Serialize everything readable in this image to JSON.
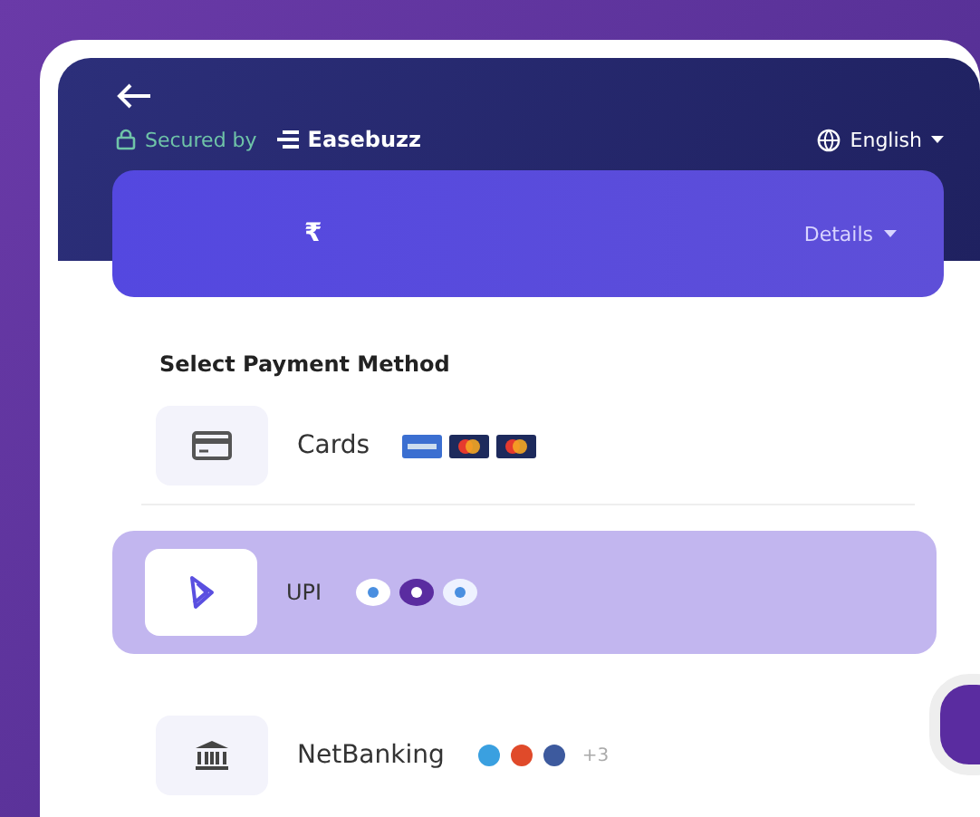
{
  "header": {
    "secured_label": "Secured by",
    "brand": "Easebuzz",
    "language": "English"
  },
  "amount_card": {
    "currency": "₹",
    "details_label": "Details"
  },
  "section_title": "Select Payment Method",
  "methods": [
    {
      "kind": "card",
      "label": "Cards",
      "selected": false,
      "logos": [
        {
          "color": "#3b6fd1"
        },
        {
          "color": "#1d2a5c"
        },
        {
          "color": "#1d2a5c"
        }
      ]
    },
    {
      "kind": "upi",
      "label": "UPI",
      "selected": true,
      "logos": [
        {
          "color": "#ffffff"
        },
        {
          "color": "#5a2ca0"
        },
        {
          "color": "#eef2ff"
        }
      ]
    },
    {
      "kind": "bank",
      "label": "NetBanking",
      "selected": false,
      "logos": [
        {
          "color": "#3aa0e0"
        },
        {
          "color": "#e04a2a"
        },
        {
          "color": "#3d5a9e"
        }
      ],
      "more": "+3"
    }
  ]
}
